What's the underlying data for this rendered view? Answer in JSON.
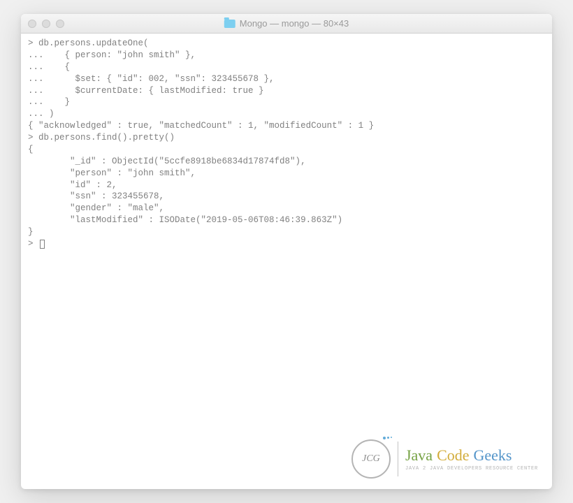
{
  "window": {
    "title": "Mongo — mongo — 80×43"
  },
  "terminal": {
    "lines": [
      "> db.persons.updateOne(",
      "...    { person: \"john smith\" },",
      "...    {",
      "...      $set: { \"id\": 002, \"ssn\": 323455678 },",
      "...      $currentDate: { lastModified: true }",
      "...    }",
      "... )",
      "{ \"acknowledged\" : true, \"matchedCount\" : 1, \"modifiedCount\" : 1 }",
      "> db.persons.find().pretty()",
      "{",
      "        \"_id\" : ObjectId(\"5ccfe8918be6834d17874fd8\"),",
      "        \"person\" : \"john smith\",",
      "        \"id\" : 2,",
      "        \"ssn\" : 323455678,",
      "        \"gender\" : \"male\",",
      "        \"lastModified\" : ISODate(\"2019-05-06T08:46:39.863Z\")",
      "}",
      "> "
    ]
  },
  "watermark": {
    "circle_text": "JCG",
    "word1": "Java",
    "word2": "Code",
    "word3": "Geeks",
    "subtitle": "Java 2 Java Developers Resource Center"
  }
}
